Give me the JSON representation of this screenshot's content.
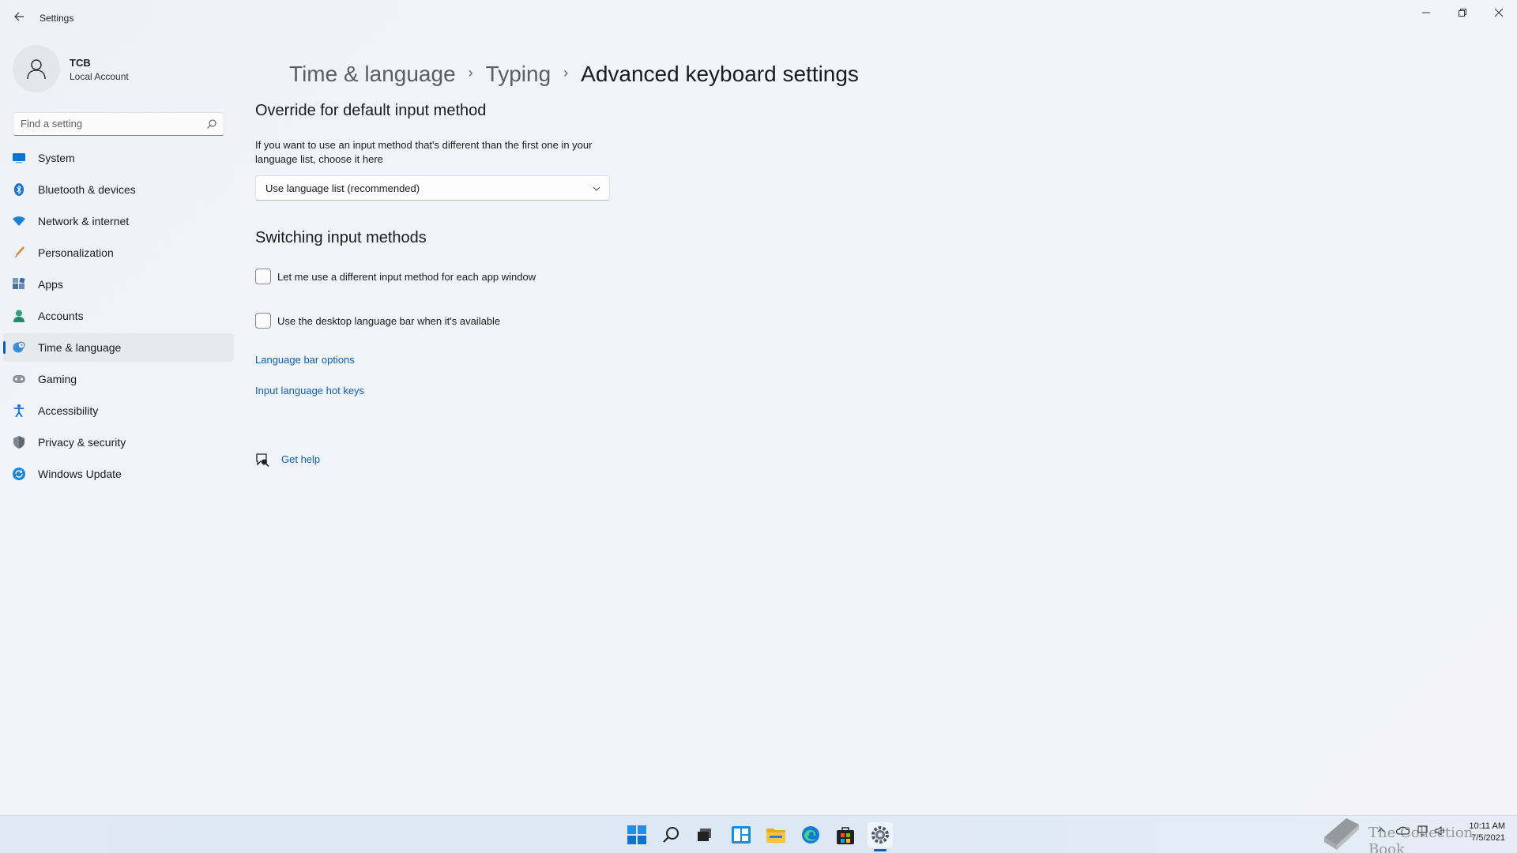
{
  "window": {
    "title": "Settings",
    "back_icon": "arrow-left",
    "minimize_icon": "minimize",
    "maximize_icon": "restore",
    "close_icon": "close"
  },
  "profile": {
    "name": "TCB",
    "account_type": "Local Account"
  },
  "search": {
    "placeholder": "Find a setting",
    "value": ""
  },
  "sidebar": {
    "items": [
      {
        "label": "System",
        "icon": "monitor",
        "active": false
      },
      {
        "label": "Bluetooth & devices",
        "icon": "bluetooth",
        "active": false
      },
      {
        "label": "Network & internet",
        "icon": "wifi",
        "active": false
      },
      {
        "label": "Personalization",
        "icon": "brush",
        "active": false
      },
      {
        "label": "Apps",
        "icon": "apps",
        "active": false
      },
      {
        "label": "Accounts",
        "icon": "person",
        "active": false
      },
      {
        "label": "Time & language",
        "icon": "globe-clock",
        "active": true
      },
      {
        "label": "Gaming",
        "icon": "gamepad",
        "active": false
      },
      {
        "label": "Accessibility",
        "icon": "accessibility",
        "active": false
      },
      {
        "label": "Privacy & security",
        "icon": "shield",
        "active": false
      },
      {
        "label": "Windows Update",
        "icon": "refresh",
        "active": false
      }
    ]
  },
  "breadcrumb": {
    "level1": "Time & language",
    "level2": "Typing",
    "current": "Advanced keyboard settings",
    "separator": "›"
  },
  "override_section": {
    "title": "Override for default input method",
    "description": "If you want to use an input method that's different than the first one in your language list, choose it here",
    "dropdown_value": "Use language list (recommended)"
  },
  "switching_section": {
    "title": "Switching input methods",
    "checkbox1_label": "Let me use a different input method for each app window",
    "checkbox1_checked": false,
    "checkbox2_label": "Use the desktop language bar when it's available",
    "checkbox2_checked": false,
    "link1": "Language bar options",
    "link2": "Input language hot keys"
  },
  "help": {
    "label": "Get help"
  },
  "taskbar": {
    "apps": [
      "start",
      "search",
      "task-view",
      "widgets",
      "file-explorer",
      "edge",
      "store",
      "settings"
    ],
    "active_app": "settings",
    "time": "10:11 AM",
    "date": "7/5/2021"
  },
  "watermark": {
    "text": "The Collection Book"
  },
  "colors": {
    "accent": "#005fb8",
    "link": "#0f5fa8",
    "active_nav_bg": "#e7e9ed"
  }
}
